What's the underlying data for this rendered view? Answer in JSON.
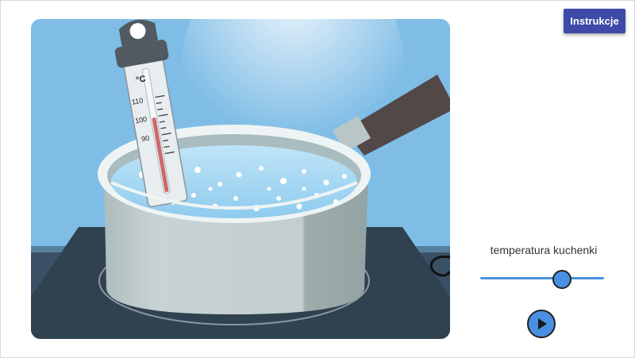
{
  "header": {
    "instructions_label": "Instrukcje"
  },
  "thermometer": {
    "unit": "°C",
    "ticks": [
      "110",
      "100",
      "90"
    ]
  },
  "controls": {
    "slider_label": "temperatura kuchenki",
    "slider_value_fraction": 0.66,
    "play_icon": "play-icon"
  },
  "colors": {
    "accent": "#4a90e2",
    "button": "#3d4aa8",
    "burner_glow": "#d0202a",
    "sky": "#7fbde6"
  }
}
